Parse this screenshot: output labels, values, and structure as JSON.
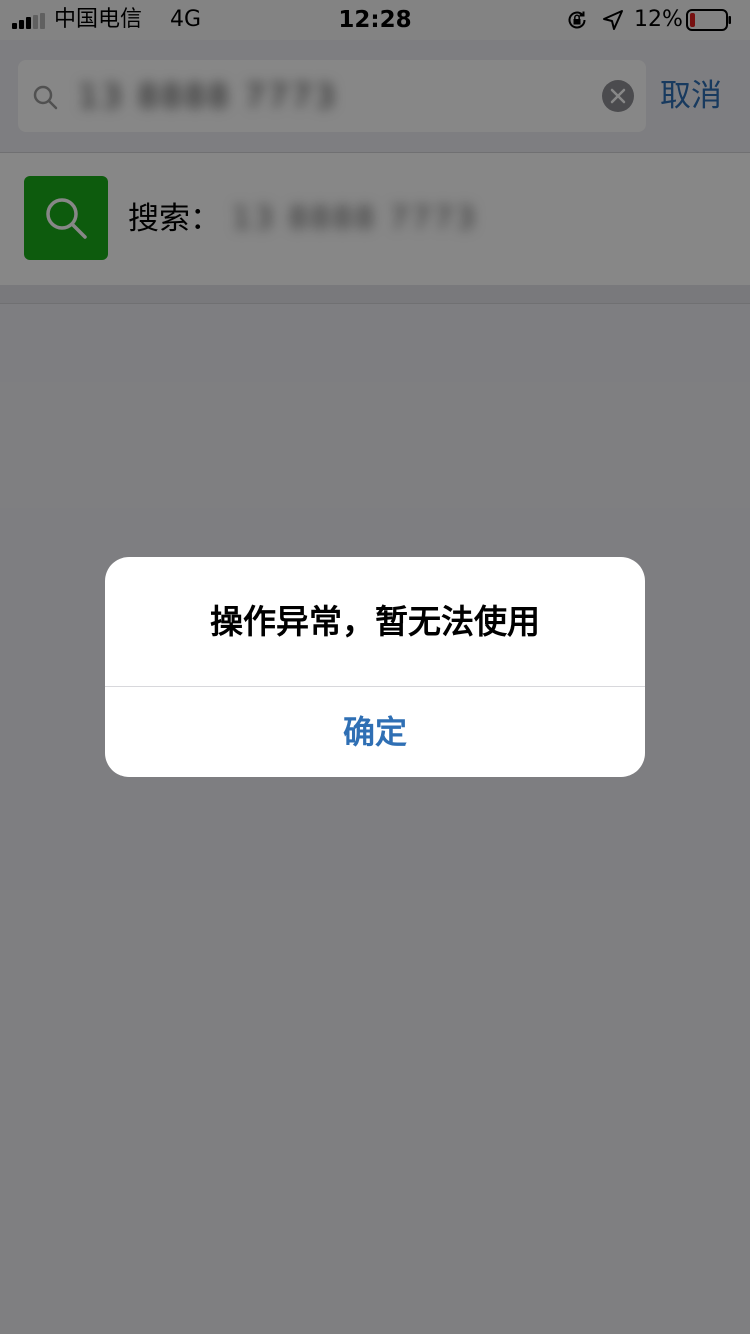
{
  "status_bar": {
    "carrier": "中国电信",
    "network": "4G",
    "time": "12:28",
    "battery_percent": "12%",
    "battery_level": 0.12,
    "battery_color": "#e02020"
  },
  "search": {
    "query": "13 8888 7773",
    "cancel_label": "取消"
  },
  "suggestion": {
    "label": "搜索：",
    "query": "13 8888 7773",
    "icon_color": "#1aad19"
  },
  "alert": {
    "title": "操作异常，暂无法使用",
    "ok_label": "确定"
  },
  "colors": {
    "accent": "#2f6fb4",
    "brand_green": "#1aad19"
  },
  "icons": {
    "signal": "signal-icon",
    "rotation_lock": "rotation-lock-icon",
    "location": "location-arrow-icon",
    "battery": "battery-icon",
    "search": "search-icon",
    "clear": "clear-icon"
  }
}
